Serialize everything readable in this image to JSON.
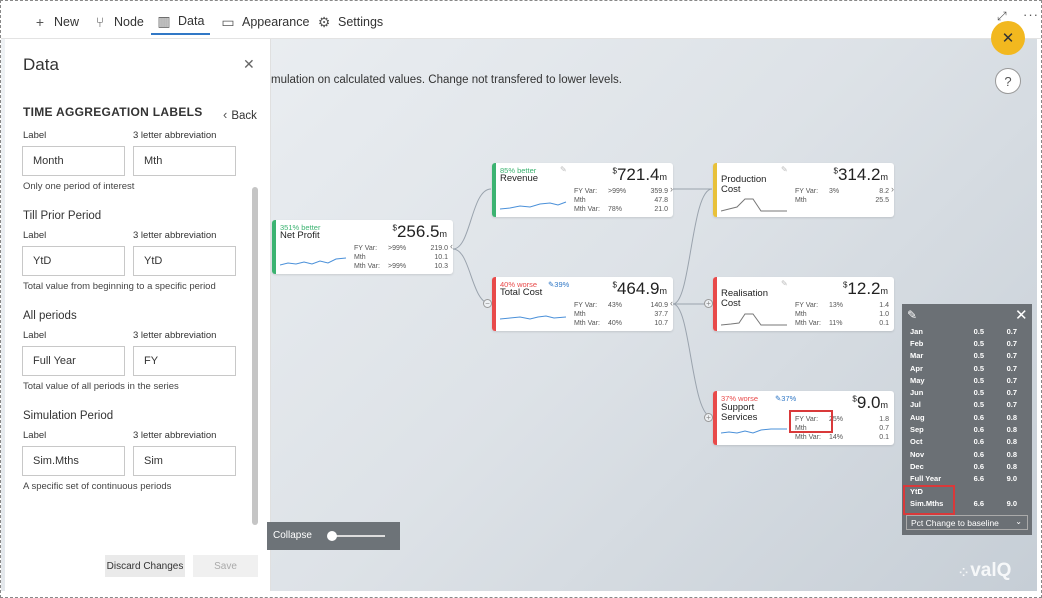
{
  "toolbar": {
    "new_label": "New",
    "node_label": "Node",
    "data_label": "Data",
    "appearance_label": "Appearance",
    "settings_label": "Settings"
  },
  "canvas": {
    "sim_message": "mulation on calculated values. Change not transfered to lower levels."
  },
  "panel": {
    "title": "Data",
    "section_title": "TIME AGGREGATION LABELS",
    "back_label": "Back",
    "label_col": "Label",
    "abbr_col": "3 letter abbreviation",
    "groups": [
      {
        "title": "",
        "label": "Month",
        "abbr": "Mth",
        "hint": "Only one period of interest"
      },
      {
        "title": "Till Prior Period",
        "label": "YtD",
        "abbr": "YtD",
        "hint": "Total value from beginning to a specific period"
      },
      {
        "title": "All periods",
        "label": "Full Year",
        "abbr": "FY",
        "hint": "Total value of all periods in the series"
      },
      {
        "title": "Simulation Period",
        "label": "Sim.Mths",
        "abbr": "Sim",
        "hint": "A specific set of continuous periods"
      }
    ],
    "discard_label": "Discard Changes",
    "save_label": "Save"
  },
  "collapse": {
    "label": "Collapse"
  },
  "nodes": {
    "net_profit": {
      "tag": "351% better",
      "name": "Net Profit",
      "cur": "$",
      "value": "256.5",
      "unit": "m",
      "rows": [
        [
          "FY Var:",
          ">99%",
          "219.0"
        ],
        [
          "Mth",
          "",
          "10.1"
        ],
        [
          "Mth Var:",
          ">99%",
          "10.3"
        ]
      ]
    },
    "revenue": {
      "tag": "85% better",
      "name": "Revenue",
      "cur": "$",
      "value": "721.4",
      "unit": "m",
      "rows": [
        [
          "FY Var:",
          ">99%",
          "359.9"
        ],
        [
          "Mth",
          "",
          "47.8"
        ],
        [
          "Mth Var:",
          "78%",
          "21.0"
        ]
      ]
    },
    "total_cost": {
      "tag": "40% worse",
      "tag2": "39%",
      "name": "Total Cost",
      "cur": "$",
      "value": "464.9",
      "unit": "m",
      "rows": [
        [
          "FY Var:",
          "43%",
          "140.9"
        ],
        [
          "Mth",
          "",
          "37.7"
        ],
        [
          "Mth Var:",
          "40%",
          "10.7"
        ]
      ]
    },
    "production_cost": {
      "name1": "Production",
      "name2": "Cost",
      "cur": "$",
      "value": "314.2",
      "unit": "m",
      "rows": [
        [
          "FY Var:",
          "3%",
          "8.2"
        ],
        [
          "Mth",
          "",
          "25.5"
        ]
      ]
    },
    "realisation_cost": {
      "name1": "Realisation",
      "name2": "Cost",
      "cur": "$",
      "value": "12.2",
      "unit": "m",
      "rows": [
        [
          "FY Var:",
          "13%",
          "1.4"
        ],
        [
          "Mth",
          "",
          "1.0"
        ],
        [
          "Mth Var:",
          "11%",
          "0.1"
        ]
      ]
    },
    "support_services": {
      "tag": "37% worse",
      "tag2": "37%",
      "name1": "Support",
      "name2": "Services",
      "cur": "$",
      "value": "9.0",
      "unit": "m",
      "rows": [
        [
          "FY Var:",
          "25%",
          "1.8"
        ],
        [
          "Mth",
          "",
          "0.7"
        ],
        [
          "Mth Var:",
          "14%",
          "0.1"
        ]
      ]
    }
  },
  "overlay": {
    "rows": [
      {
        "m": "Jan",
        "a": "0.5",
        "b": "0.7"
      },
      {
        "m": "Feb",
        "a": "0.5",
        "b": "0.7"
      },
      {
        "m": "Mar",
        "a": "0.5",
        "b": "0.7"
      },
      {
        "m": "Apr",
        "a": "0.5",
        "b": "0.7"
      },
      {
        "m": "May",
        "a": "0.5",
        "b": "0.7"
      },
      {
        "m": "Jun",
        "a": "0.5",
        "b": "0.7"
      },
      {
        "m": "Jul",
        "a": "0.5",
        "b": "0.7"
      },
      {
        "m": "Aug",
        "a": "0.6",
        "b": "0.8"
      },
      {
        "m": "Sep",
        "a": "0.6",
        "b": "0.8"
      },
      {
        "m": "Oct",
        "a": "0.6",
        "b": "0.8"
      },
      {
        "m": "Nov",
        "a": "0.6",
        "b": "0.8"
      },
      {
        "m": "Dec",
        "a": "0.6",
        "b": "0.8"
      },
      {
        "m": "Full Year",
        "a": "6.6",
        "b": "9.0"
      },
      {
        "m": "YtD",
        "a": "",
        "b": ""
      },
      {
        "m": "Sim.Mths",
        "a": "6.6",
        "b": "9.0"
      }
    ],
    "select_value": "Pct Change to baseline"
  },
  "brand": "valQ",
  "colors": {
    "good": "#3cb371",
    "bad": "#e84a4a",
    "neutral": "#e8c13a",
    "accent": "#f2b81f",
    "highlight": "#d9393a"
  }
}
